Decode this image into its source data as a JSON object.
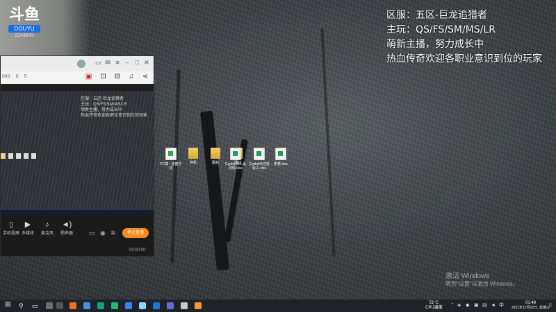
{
  "stream_logo": {
    "mark": "斗鱼",
    "badge": "DOUYU",
    "room_id": "2243843"
  },
  "stream_overlay": {
    "lines": [
      "区服：五区-巨龙追猎者",
      "主玩：QS/FS/SM/MS/LR",
      "萌新主播，努力成长中",
      "热血传奇欢迎各职业意识到位的玩家"
    ]
  },
  "app_window": {
    "stats": [
      "843",
      "8",
      "5"
    ],
    "preview_text": [
      "区服：五区-巨龙追猎者",
      "主玩：QS/FS/SM/MS/LR",
      "萌新主播，努力成长中",
      "热血传奇欢迎各职业意识到位的玩家"
    ],
    "controls": [
      {
        "icon": "phone-icon",
        "label": "手机投屏"
      },
      {
        "icon": "play-icon",
        "label": "多媒体"
      },
      {
        "icon": "mic-icon",
        "label": "麦克风"
      },
      {
        "icon": "speaker-icon",
        "label": "扬声器"
      }
    ],
    "start_button": "停止直播",
    "live_time": "00:00:00"
  },
  "desktop_icons": [
    {
      "type": "file",
      "label": "PC端 - 快捷方式"
    },
    {
      "type": "folder",
      "label": "随机"
    },
    {
      "type": "folder",
      "label": "图标"
    },
    {
      "type": "folder",
      "label": "活动"
    },
    {
      "type": "sheet",
      "label": "CypfaHA入会详情.xlsx"
    },
    {
      "type": "sheet",
      "label": "CypfaHA已经收工.xlsx"
    },
    {
      "type": "sheet",
      "label": "表格.xlsx"
    }
  ],
  "watermark": {
    "title": "激活 Windows",
    "subtitle": "转到\"设置\"以激活 Windows。"
  },
  "taskbar": {
    "weather": "51°C",
    "weather_sub": "CPU温度",
    "time": "01:48",
    "date": "2021年12月22日, 星期三",
    "app_colors": [
      "#e9702a",
      "#4a90e2",
      "#14a37f",
      "#2bb673",
      "#3a82f7",
      "#8fd3ff",
      "#1f76c9",
      "#5b6fd6",
      "#c8c8c8",
      "#f39c32"
    ]
  }
}
